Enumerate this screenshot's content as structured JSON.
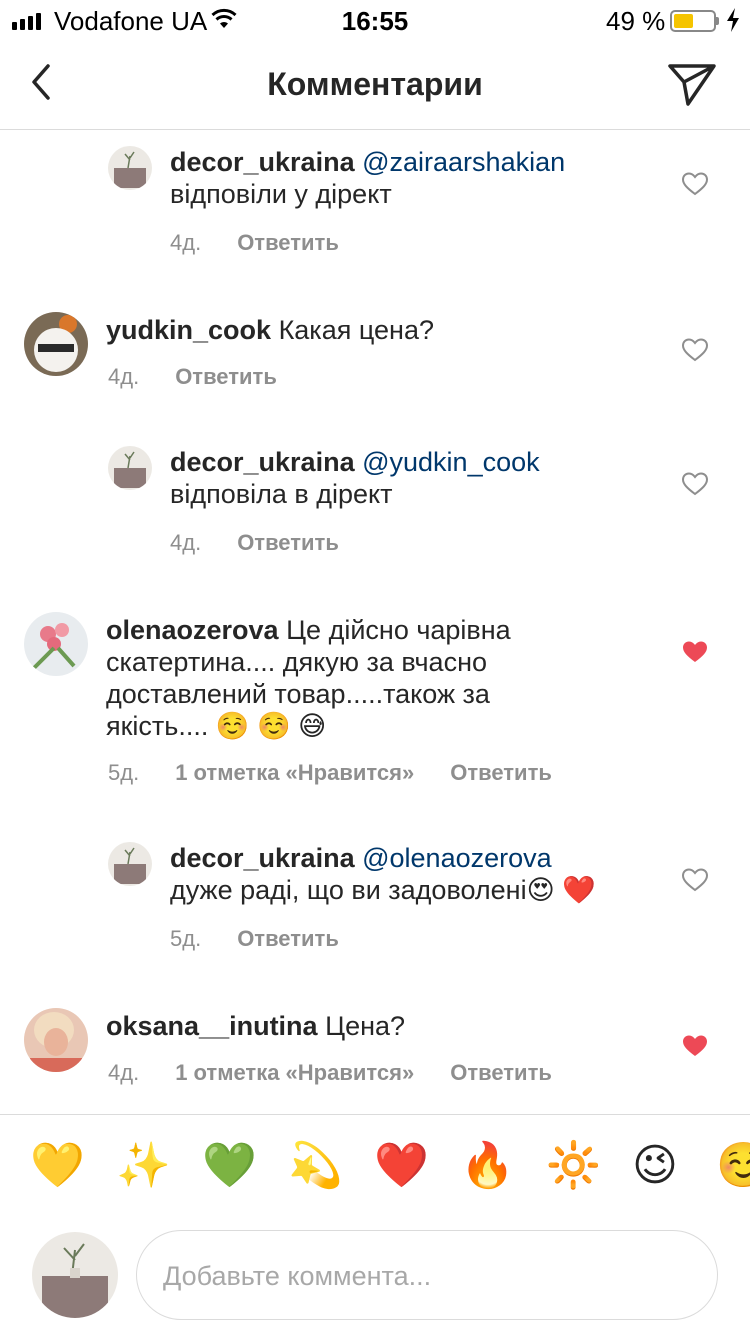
{
  "status_bar": {
    "carrier": "Vodafone UA",
    "time": "16:55",
    "battery_percent": "49 %",
    "battery_level": 0.49
  },
  "nav": {
    "title": "Комментарии"
  },
  "comments": [
    {
      "username": "decor_ukraina",
      "mention": "@zairaarshakian",
      "text_line1": "",
      "text_line2": "відповіли у дірект",
      "time": "4д.",
      "likes": "",
      "reply": "Ответить",
      "liked": false,
      "is_reply": true
    },
    {
      "username": "yudkin_cook",
      "text": "Какая цена?",
      "time": "4д.",
      "likes": "",
      "reply": "Ответить",
      "liked": false,
      "is_reply": false
    },
    {
      "username": "decor_ukraina",
      "mention": "@yudkin_cook",
      "text_line2": "відповіла в дірект",
      "time": "4д.",
      "likes": "",
      "reply": "Ответить",
      "liked": false,
      "is_reply": true
    },
    {
      "username": "olenaozerova",
      "text_line1": "Це дійсно чарівна",
      "text_line2": "скатертина.... дякую за вчасно",
      "text_line3": "доставлений товар.....також за",
      "text_line4": "якість.... ☺️ ☺️ 😅",
      "time": "5д.",
      "likes": "1 отметка «Нравится»",
      "reply": "Ответить",
      "liked": true,
      "is_reply": false
    },
    {
      "username": "decor_ukraina",
      "mention": "@olenaozerova",
      "text_line2": "дуже раді, що ви задоволені😍 ❤️",
      "time": "5д.",
      "likes": "",
      "reply": "Ответить",
      "liked": false,
      "is_reply": true
    },
    {
      "username": "oksana__inutina",
      "text": "Цена?",
      "time": "4д.",
      "likes": "1 отметка «Нравится»",
      "reply": "Ответить",
      "liked": true,
      "is_reply": false
    }
  ],
  "emoji_bar": [
    "💛",
    "✨",
    "💚",
    "💫",
    "❤️",
    "🔥",
    "🔆",
    "😉",
    "☺️"
  ],
  "input": {
    "placeholder": "Добавьте коммента..."
  },
  "colors": {
    "liked_heart": "#ed4956",
    "mention": "#00376b",
    "meta": "#8e8e8e",
    "battery": "#f5c400"
  }
}
